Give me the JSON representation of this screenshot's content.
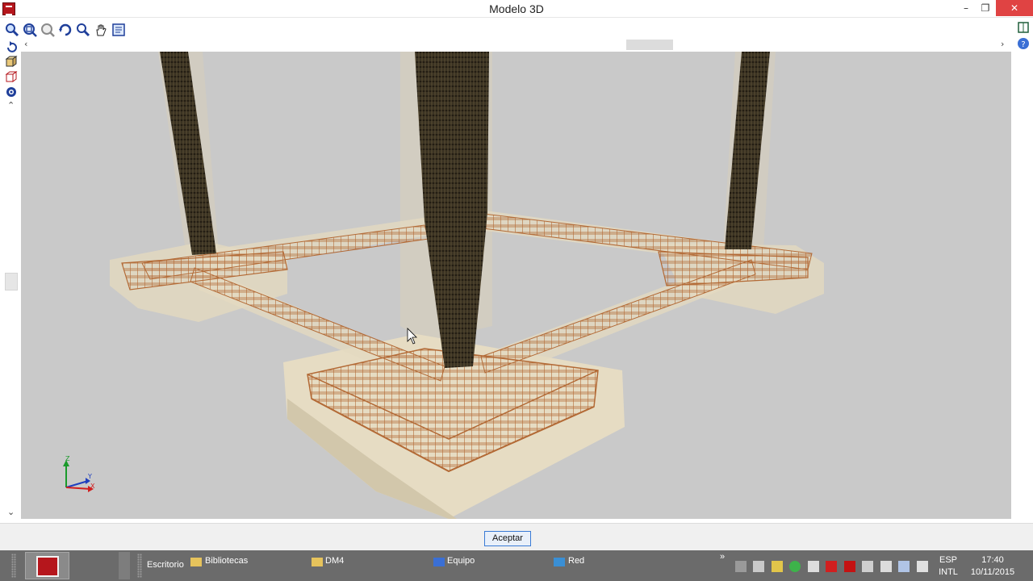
{
  "window": {
    "title": "Modelo 3D",
    "minimize": "–",
    "restore": "❐",
    "close": "✕"
  },
  "toolbar": {
    "icons": [
      "zoom-window-icon",
      "zoom-all-icon",
      "zoom-previous-icon",
      "refresh-view-icon",
      "zoom-icon",
      "pan-hand-icon",
      "view-settings-icon"
    ]
  },
  "left_tools": {
    "icons": [
      "rotate-icon",
      "solid-view-icon",
      "wireframe-view-icon",
      "view-options-icon"
    ]
  },
  "axes": {
    "z": "Z",
    "y": "Y",
    "x": "X"
  },
  "dialog": {
    "accept_label": "Aceptar"
  },
  "taskbar": {
    "escritorio": "Escritorio",
    "bibliotecas": "Bibliotecas",
    "dm4": "DM4",
    "equipo": "Equipo",
    "red": "Red",
    "overflow": "»",
    "lang_top": "ESP",
    "lang_bottom": "INTL",
    "time": "17:40",
    "date": "10/11/2015"
  },
  "colors": {
    "viewport_bg": "#c9c9c9",
    "rebar": "#b36a36",
    "column_rebar": "#2a2418",
    "concrete": "#e6dcc3",
    "accent": "#b5161c"
  }
}
